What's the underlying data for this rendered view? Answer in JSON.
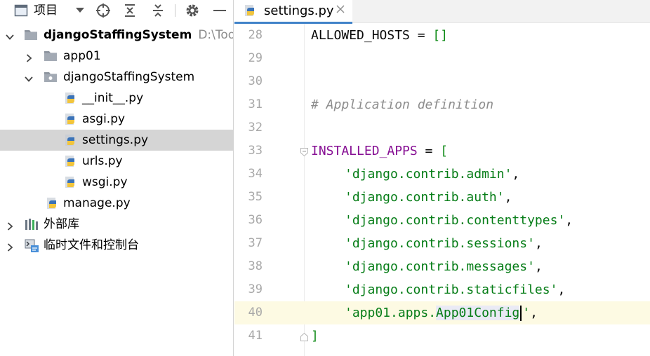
{
  "project_panel": {
    "title": "项目",
    "toolbar_icons": [
      "project-view-icon",
      "dropdown-arrow-icon",
      "locate-icon",
      "expand-all-icon",
      "collapse-all-icon",
      "gear-icon",
      "minimize-icon"
    ],
    "tree": [
      {
        "label": "djangoStaffingSystem",
        "path": "D:\\Tool",
        "icon": "folder-icon",
        "expanded": true,
        "bold": true
      },
      {
        "label": "app01",
        "icon": "folder-icon",
        "expanded": false
      },
      {
        "label": "djangoStaffingSystem",
        "icon": "folder-icon",
        "expanded": true
      },
      {
        "label": "__init__.py",
        "icon": "python-file-icon"
      },
      {
        "label": "asgi.py",
        "icon": "python-file-icon"
      },
      {
        "label": "settings.py",
        "icon": "python-file-icon",
        "selected": true
      },
      {
        "label": "urls.py",
        "icon": "python-file-icon"
      },
      {
        "label": "wsgi.py",
        "icon": "python-file-icon"
      },
      {
        "label": "manage.py",
        "icon": "python-file-icon"
      },
      {
        "label": "外部库",
        "icon": "library-icon",
        "expanded": false
      },
      {
        "label": "临时文件和控制台",
        "icon": "scratch-icon",
        "expanded": false
      }
    ]
  },
  "editor": {
    "tab": {
      "label": "settings.py",
      "icon": "python-file-icon",
      "close_icon": "close-icon"
    },
    "lines": [
      {
        "number": "28",
        "text": "ALLOWED_HOSTS = []"
      },
      {
        "number": "29",
        "text": ""
      },
      {
        "number": "30",
        "text": ""
      },
      {
        "number": "31",
        "text": "# Application definition"
      },
      {
        "number": "32",
        "text": ""
      },
      {
        "number": "33",
        "text": "INSTALLED_APPS = ["
      },
      {
        "number": "34",
        "text": "'django.contrib.admin',"
      },
      {
        "number": "35",
        "text": "'django.contrib.auth',"
      },
      {
        "number": "36",
        "text": "'django.contrib.contenttypes',"
      },
      {
        "number": "37",
        "text": "'django.contrib.sessions',"
      },
      {
        "number": "38",
        "text": "'django.contrib.messages',"
      },
      {
        "number": "39",
        "text": "'django.contrib.staticfiles',"
      },
      {
        "number": "40",
        "text": "'app01.apps.App01Config',"
      },
      {
        "number": "41",
        "text": "]"
      }
    ],
    "caret_line": "40"
  },
  "colors": {
    "string": "#067d17",
    "comment": "#8c8c8c",
    "identifier": "#871094",
    "selection": "#d5d5d5",
    "caret_line": "#fdfae3",
    "tab_underline": "#4083c9"
  }
}
